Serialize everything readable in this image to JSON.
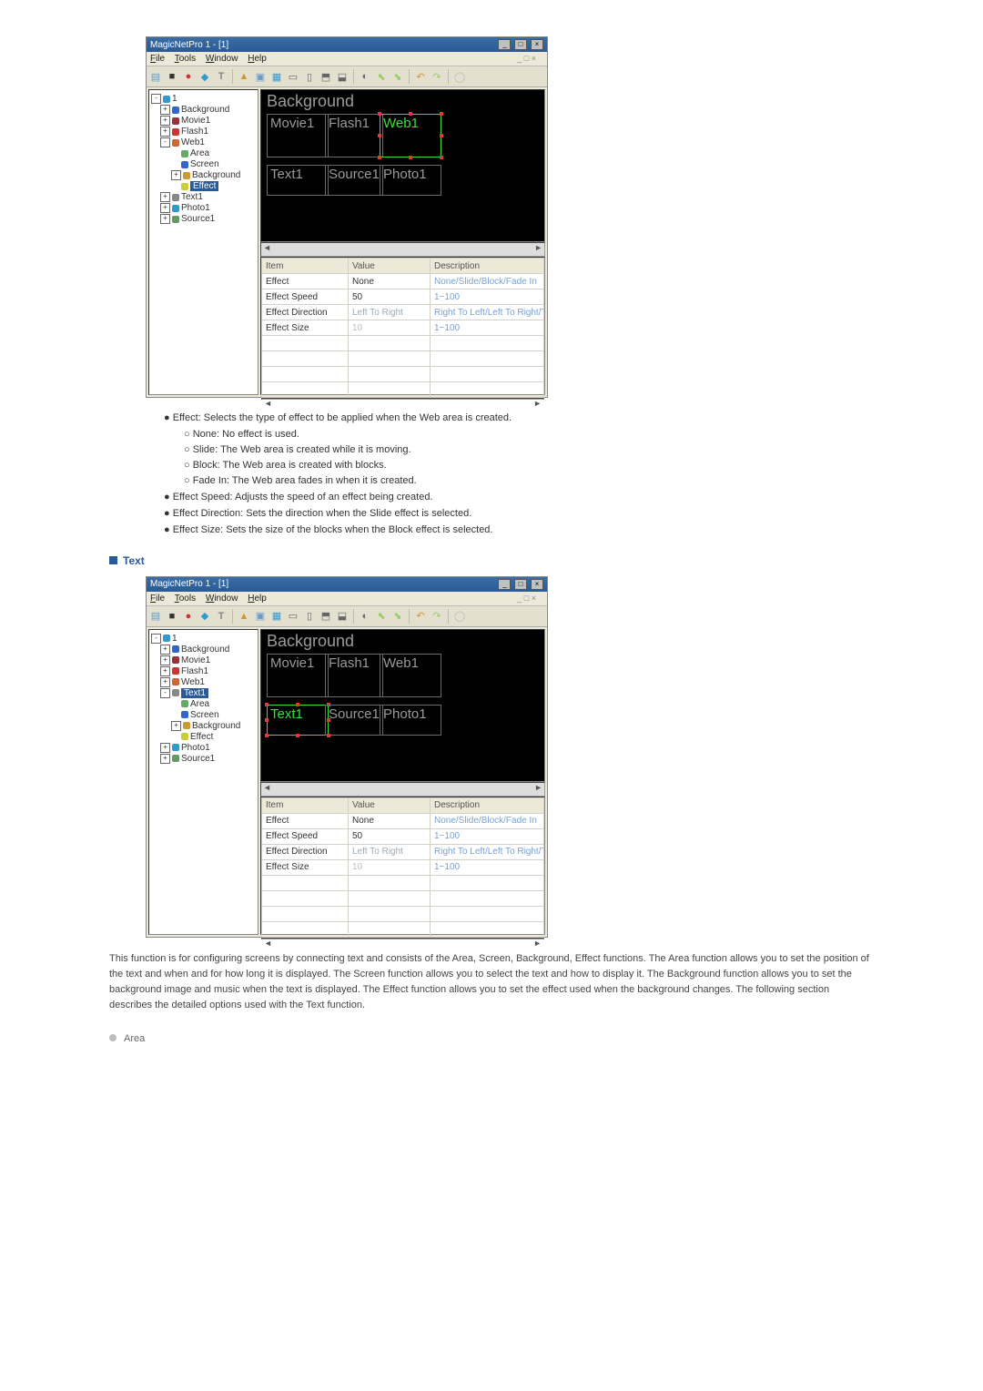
{
  "screenshot1": {
    "title": "MagicNetPro 1 - [1]",
    "menu": {
      "file": "File",
      "tools": "Tools",
      "window": "Window",
      "help": "Help"
    },
    "tree": {
      "root": "1",
      "items": [
        "Background",
        "Movie1",
        "Flash1",
        "Web1"
      ],
      "web_children": [
        "Area",
        "Screen",
        "Background",
        "Effect"
      ],
      "after": [
        "Text1",
        "Photo1",
        "Source1"
      ],
      "selected": "Effect"
    },
    "canvas": {
      "bg": "Background",
      "movie": "Movie1",
      "flash": "Flash1",
      "web": "Web1",
      "text": "Text1",
      "source": "Source1",
      "photo": "Photo1"
    },
    "grid": {
      "headers": {
        "item": "Item",
        "value": "Value",
        "desc": "Description"
      },
      "rows": [
        {
          "item": "Effect",
          "value": "None",
          "desc": "None/Slide/Block/Fade In"
        },
        {
          "item": "Effect Speed",
          "value": "50",
          "desc": "1~100"
        },
        {
          "item": "Effect Direction",
          "value": "Left To Right",
          "desc": "Right To Left/Left To Right/Top To Bottom"
        },
        {
          "item": "Effect Size",
          "value": "10",
          "desc": "1~100"
        }
      ]
    }
  },
  "doc1": {
    "b1": "Effect: Selects the type of effect to be applied when the Web area is created.",
    "s1": "None: No effect is used.",
    "s2": "Slide: The Web area is created while it is moving.",
    "s3": "Block: The Web area is created with blocks.",
    "s4": "Fade In: The Web area fades in when it is created.",
    "b2": "Effect Speed: Adjusts the speed of an effect being created.",
    "b3": "Effect Direction: Sets the direction when the Slide effect is selected.",
    "b4": "Effect Size: Sets the size of the blocks when the Block effect is selected."
  },
  "section_text_title": "Text",
  "screenshot2": {
    "title": "MagicNetPro 1 - [1]",
    "tree": {
      "root": "1",
      "items": [
        "Background",
        "Movie1",
        "Flash1",
        "Web1",
        "Text1"
      ],
      "text_children": [
        "Area",
        "Screen",
        "Background",
        "Effect"
      ],
      "after": [
        "Photo1",
        "Source1"
      ],
      "selected": "Text1"
    },
    "canvas": {
      "bg": "Background",
      "movie": "Movie1",
      "flash": "Flash1",
      "web": "Web1",
      "text": "Text1",
      "source": "Source1",
      "photo": "Photo1"
    },
    "grid": {
      "headers": {
        "item": "Item",
        "value": "Value",
        "desc": "Description"
      },
      "rows": [
        {
          "item": "Effect",
          "value": "None",
          "desc": "None/Slide/Block/Fade In"
        },
        {
          "item": "Effect Speed",
          "value": "50",
          "desc": "1~100"
        },
        {
          "item": "Effect Direction",
          "value": "Left To Right",
          "desc": "Right To Left/Left To Right/Top To Bottom"
        },
        {
          "item": "Effect Size",
          "value": "10",
          "desc": "1~100"
        }
      ]
    }
  },
  "doc2": {
    "para": "This function is for configuring screens by connecting text and consists of the Area, Screen, Background, Effect functions. The Area function allows you to set the position of the text and when and for how long it is displayed. The Screen function allows you to select the text and how to display it. The Background function allows you to set the background image and music when the text is displayed. The Effect function allows you to set the effect used when the background changes. The following section describes the detailed options used with the Text function."
  },
  "area_heading": "Area"
}
